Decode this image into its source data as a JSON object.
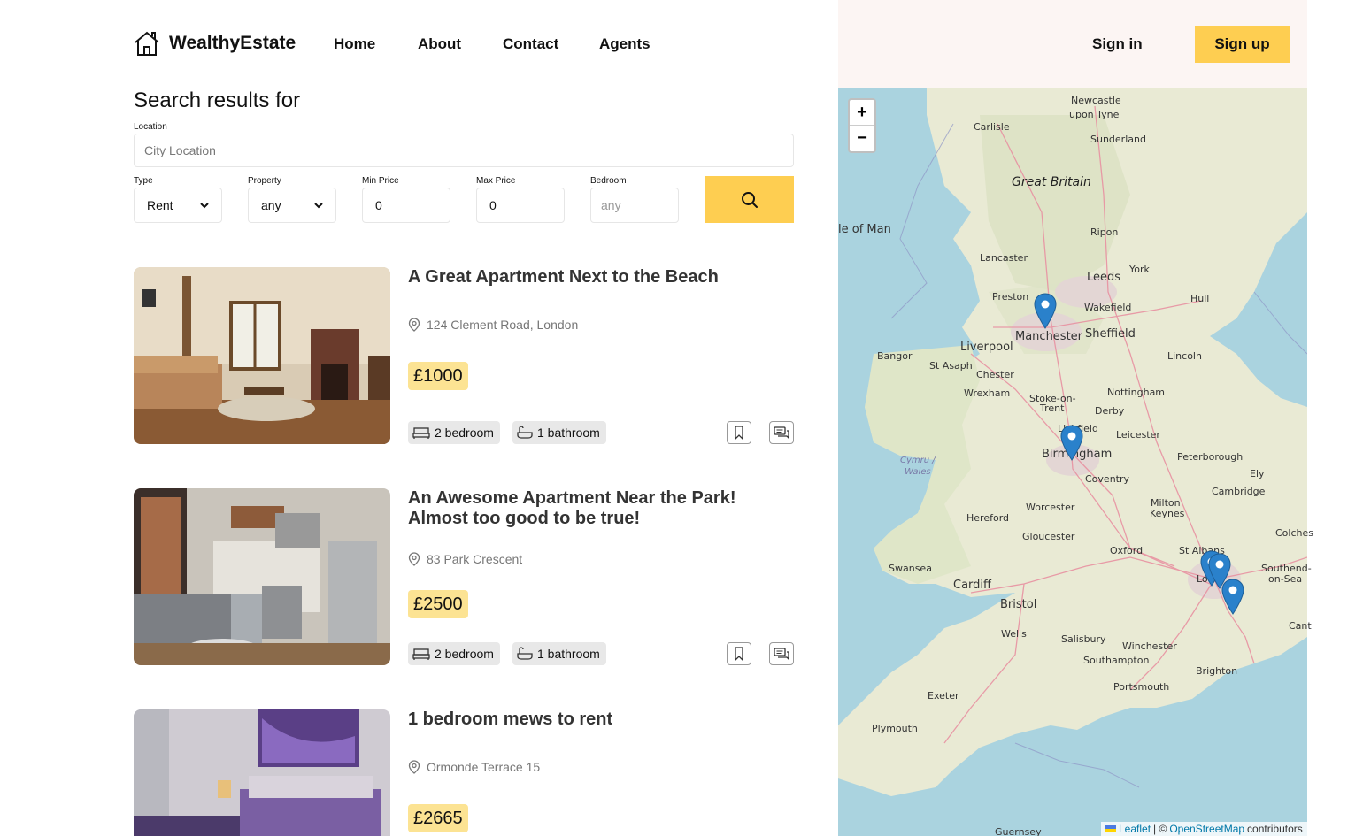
{
  "brand": {
    "name": "WealthyEstate",
    "logo_icon": "house-icon"
  },
  "nav": {
    "links": [
      "Home",
      "About",
      "Contact",
      "Agents"
    ],
    "signin": "Sign in",
    "signup": "Sign up"
  },
  "colors": {
    "accent": "#fece51",
    "price_bg": "#fce393",
    "panel_bg": "#fcf5f3"
  },
  "search": {
    "title": "Search results for",
    "location_label": "Location",
    "location_placeholder": "City Location",
    "type_label": "Type",
    "type_value": "Rent",
    "property_label": "Property",
    "property_value": "any",
    "min_label": "Min Price",
    "min_value": "0",
    "max_label": "Max Price",
    "max_value": "0",
    "bedroom_label": "Bedroom",
    "bedroom_placeholder": "any",
    "button_icon": "search-icon"
  },
  "listings": [
    {
      "title": "A Great Apartment Next to the Beach",
      "address": "124 Clement Road, London",
      "price": "£1000",
      "bedroom": "2 bedroom",
      "bathroom": "1 bathroom"
    },
    {
      "title": "An Awesome Apartment Near the Park! Almost too good to be true!",
      "address": "83 Park Crescent",
      "price": "£2500",
      "bedroom": "2 bedroom",
      "bathroom": "1 bathroom"
    },
    {
      "title": "1 bedroom mews to rent",
      "address": "Ormonde Terrace 15",
      "price": "£2665"
    }
  ],
  "map": {
    "zoom_in": "+",
    "zoom_out": "−",
    "attribution": {
      "leaflet": "Leaflet",
      "sep": "| ©",
      "osm": "OpenStreetMap",
      "suffix": "contributors"
    },
    "labels": {
      "newcastle": "Newcastle",
      "upon_tyne": "upon Tyne",
      "carlisle": "Carlisle",
      "sunderland": "Sunderland",
      "great_britain": "Great Britain",
      "isle_of_man": "le of Man",
      "ripon": "Ripon",
      "lancaster": "Lancaster",
      "york": "York",
      "leeds": "Leeds",
      "preston": "Preston",
      "wakefield": "Wakefield",
      "hull": "Hull",
      "manchester": "Manchester",
      "sheffield": "Sheffield",
      "liverpool": "Liverpool",
      "bangor": "Bangor",
      "st_asaph": "St Asaph",
      "lincoln": "Lincoln",
      "chester": "Chester",
      "wrexham": "Wrexham",
      "nottingham": "Nottingham",
      "stoke": "Stoke-on-",
      "trent": "Trent",
      "derby": "Derby",
      "lichfield": "Lichfield",
      "leicester": "Leicester",
      "birmingham": "Birmingham",
      "peterborough": "Peterborough",
      "ely": "Ely",
      "cymru": "Cymru /",
      "wales": "Wales",
      "coventry": "Coventry",
      "cambridge": "Cambridge",
      "worcester": "Worcester",
      "hereford": "Hereford",
      "milton": "Milton",
      "keynes": "Keynes",
      "gloucester": "Gloucester",
      "colchester": "Colches",
      "swansea": "Swansea",
      "oxford": "Oxford",
      "st_albans": "St Albans",
      "southend": "Southend-",
      "on_sea": "on-Sea",
      "cardiff": "Cardiff",
      "london": "Lo",
      "bristol": "Bristol",
      "wells": "Wells",
      "salisbury": "Salisbury",
      "winchester": "Winchester",
      "southampton": "Southampton",
      "brighton": "Brighton",
      "canterbury": "Cant",
      "portsmouth": "Portsmouth",
      "exeter": "Exeter",
      "plymouth": "Plymouth",
      "guernsey": "Guernsey"
    }
  }
}
